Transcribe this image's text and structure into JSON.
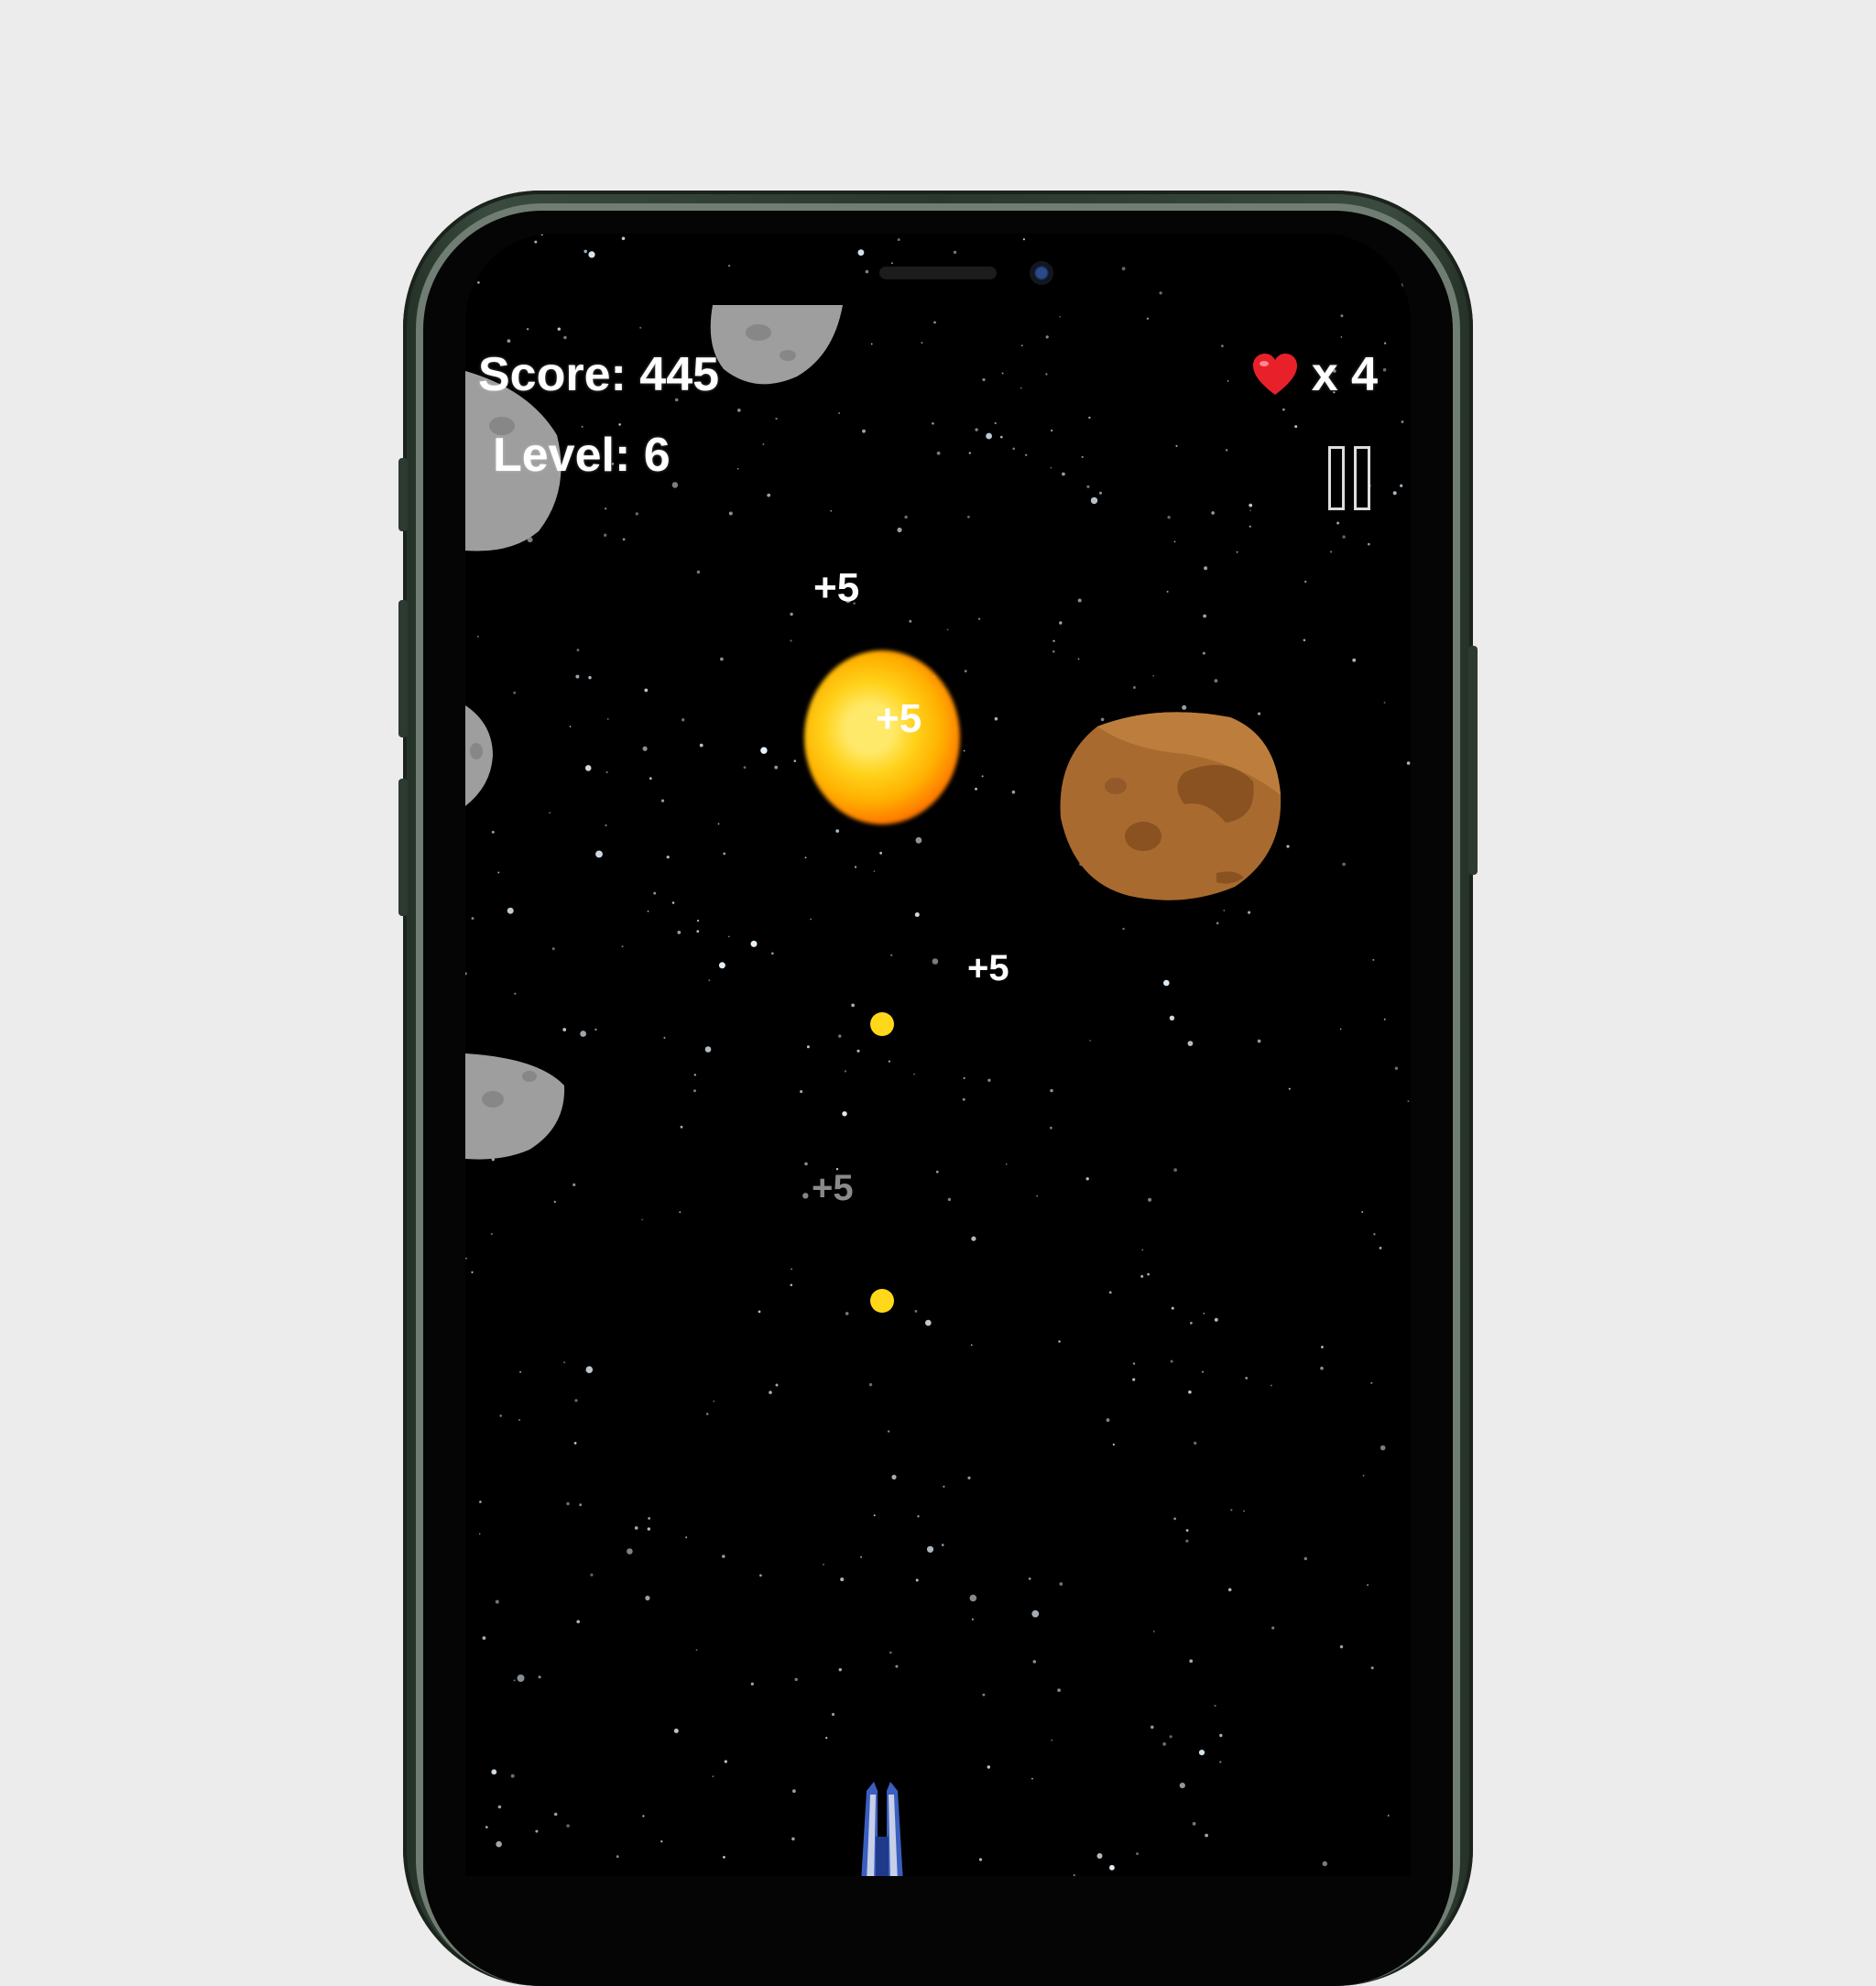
{
  "hud": {
    "score": "Score: 445",
    "level": "Level: 6",
    "lives_icon": "heart-icon",
    "lives": "x 4",
    "pause_icon": "pause-icon"
  },
  "popups": [
    "+5",
    "+5",
    "+5",
    "+5"
  ],
  "colors": {
    "background": "#000000",
    "bullet": "#ffd81a",
    "asteroid_brown": "#a86a2e",
    "asteroid_gray": "#9e9e9e",
    "explosion": "#ffb000"
  }
}
